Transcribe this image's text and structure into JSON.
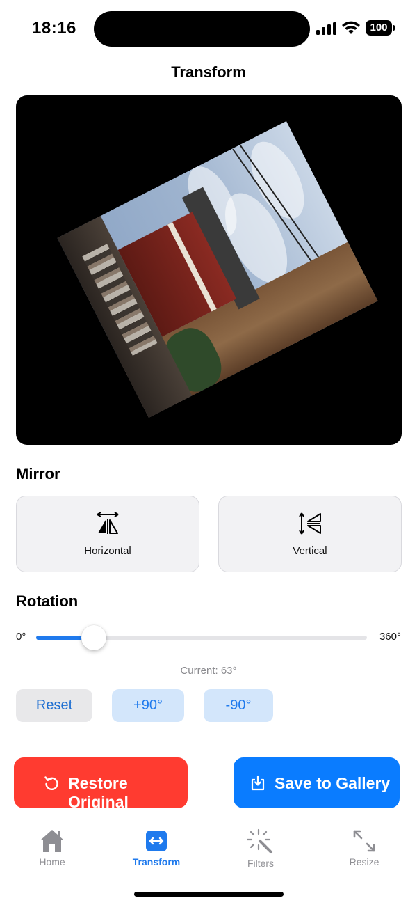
{
  "status_bar": {
    "time": "18:16",
    "battery": "100",
    "icons": [
      "signal-icon",
      "wifi-icon",
      "battery-icon"
    ]
  },
  "nav": {
    "title": "Transform"
  },
  "preview": {
    "rotation_degrees": 63
  },
  "mirror": {
    "title": "Mirror",
    "horizontal_label": "Horizontal",
    "vertical_label": "Vertical",
    "icons": [
      "flip-horizontal-icon",
      "flip-vertical-icon"
    ]
  },
  "rotation": {
    "title": "Rotation",
    "min_label": "0°",
    "max_label": "360°",
    "value": 63,
    "min": 0,
    "max": 360,
    "current_text": "Current: 63°",
    "reset_label": "Reset",
    "plus_label": "+90°",
    "minus_label": "-90°"
  },
  "actions": {
    "restore_label": "Restore Original",
    "save_label": "Save to Gallery",
    "icons": [
      "restore-icon",
      "download-icon"
    ]
  },
  "tabs": [
    {
      "label": "Home",
      "icon": "home-icon",
      "active": false
    },
    {
      "label": "Transform",
      "icon": "transform-icon",
      "active": true
    },
    {
      "label": "Filters",
      "icon": "magic-wand-icon",
      "active": false
    },
    {
      "label": "Resize",
      "icon": "resize-icon",
      "active": false
    }
  ],
  "colors": {
    "accent": "#1f7aed",
    "restore": "#ff3b30",
    "save": "#0a7cff",
    "inactive_tab": "#8e8e93"
  }
}
